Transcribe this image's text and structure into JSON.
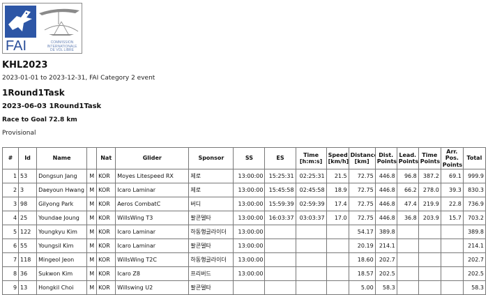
{
  "logo": {
    "acronym": "FAI",
    "commission_lines": [
      "COMMISSION",
      "INTERNATIONALE",
      "DE VOL LIBRE"
    ]
  },
  "competition": {
    "title": "KHL2023",
    "date_range": "2023-01-01 to 2023-12-31, FAI Category 2 event"
  },
  "task": {
    "title": "1Round1Task",
    "subtitle": "2023-06-03 1Round1Task",
    "race": "Race to Goal 72.8 km",
    "status": "Provisional"
  },
  "table": {
    "headers": [
      "#",
      "Id",
      "Name",
      "",
      "Nat",
      "Glider",
      "Sponsor",
      "SS",
      "ES",
      "Time [h:m:s]",
      "Speed [km/h]",
      "Distance [km]",
      "Dist. Points",
      "Lead. Points",
      "Time Points",
      "Arr. Pos. Points",
      "Total"
    ],
    "rows": [
      [
        "1",
        "53",
        "Dongsun Jang",
        "M",
        "KOR",
        "Moyes Litespeed RX",
        "제로",
        "13:00:00",
        "15:25:31",
        "02:25:31",
        "21.5",
        "72.75",
        "446.8",
        "96.8",
        "387.2",
        "69.1",
        "999.9"
      ],
      [
        "2",
        "3",
        "Daeyoun Hwang",
        "M",
        "KOR",
        "Icaro Laminar",
        "제로",
        "13:00:00",
        "15:45:58",
        "02:45:58",
        "18.9",
        "72.75",
        "446.8",
        "66.2",
        "278.0",
        "39.3",
        "830.3"
      ],
      [
        "3",
        "98",
        "Gilyong Park",
        "M",
        "KOR",
        "Aeros CombatC",
        "버디",
        "13:00:00",
        "15:59:39",
        "02:59:39",
        "17.4",
        "72.75",
        "446.8",
        "47.4",
        "219.9",
        "22.8",
        "736.9"
      ],
      [
        "4",
        "25",
        "Youndae Joung",
        "M",
        "KOR",
        "WillsWing T3",
        "팔콘델타",
        "13:00:00",
        "16:03:37",
        "03:03:37",
        "17.0",
        "72.75",
        "446.8",
        "36.8",
        "203.9",
        "15.7",
        "703.2"
      ],
      [
        "5",
        "122",
        "Youngkyu Kim",
        "M",
        "KOR",
        "Icaro Laminar",
        "하동행글라이더",
        "13:00:00",
        "",
        "",
        "",
        "54.17",
        "389.8",
        "",
        "",
        "",
        "389.8"
      ],
      [
        "6",
        "55",
        "Youngsil Kim",
        "M",
        "KOR",
        "Icaro Laminar",
        "팔콘델타",
        "13:00:00",
        "",
        "",
        "",
        "20.19",
        "214.1",
        "",
        "",
        "",
        "214.1"
      ],
      [
        "7",
        "118",
        "Mingeol Jeon",
        "M",
        "KOR",
        "WillsWing T2C",
        "하동행글라이더",
        "13:00:00",
        "",
        "",
        "",
        "18.60",
        "202.7",
        "",
        "",
        "",
        "202.7"
      ],
      [
        "8",
        "36",
        "Sukwon Kim",
        "M",
        "KOR",
        "Icaro Z8",
        "프리버드",
        "13:00:00",
        "",
        "",
        "",
        "18.57",
        "202.5",
        "",
        "",
        "",
        "202.5"
      ],
      [
        "9",
        "13",
        "Hongkil Choi",
        "M",
        "KOR",
        "Willswing U2",
        "팔콘델타",
        "",
        "",
        "",
        "",
        "5.00",
        "58.3",
        "",
        "",
        "",
        "58.3"
      ]
    ]
  }
}
